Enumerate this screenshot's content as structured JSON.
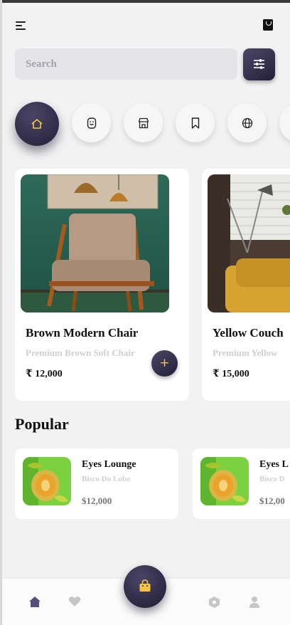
{
  "header": {
    "menu_icon": "menu-icon",
    "bag_icon": "shopping-bag-icon"
  },
  "search": {
    "placeholder": "Search",
    "filter_icon": "sliders-icon"
  },
  "categories": [
    {
      "icon": "home-icon",
      "active": true
    },
    {
      "icon": "mouse-icon"
    },
    {
      "icon": "store-icon"
    },
    {
      "icon": "bookmark-icon"
    },
    {
      "icon": "globe-icon"
    }
  ],
  "products": [
    {
      "name": "Brown Modern Chair",
      "subtitle": "Premium Brown Soft Chair",
      "price": "₹ 12,000",
      "add_label": "+"
    },
    {
      "name": "Yellow Couch",
      "subtitle": "Premium Yellow",
      "price": "₹ 15,000",
      "add_label": "+"
    }
  ],
  "popular": {
    "title": "Popular",
    "items": [
      {
        "name": "Eyes Lounge",
        "brand": "Bisco Do Lobo",
        "price": "$12,000"
      },
      {
        "name": "Eyes L",
        "brand": "Bisco D",
        "price": "$12,00"
      }
    ]
  },
  "bottom_nav": {
    "items": [
      "home-icon",
      "heart-icon",
      "cube-icon",
      "user-icon"
    ],
    "fab_icon": "shopping-bag-icon"
  },
  "colors": {
    "accent": "#f6c445",
    "dark": "#2c2842",
    "background": "#f3f2f3"
  }
}
